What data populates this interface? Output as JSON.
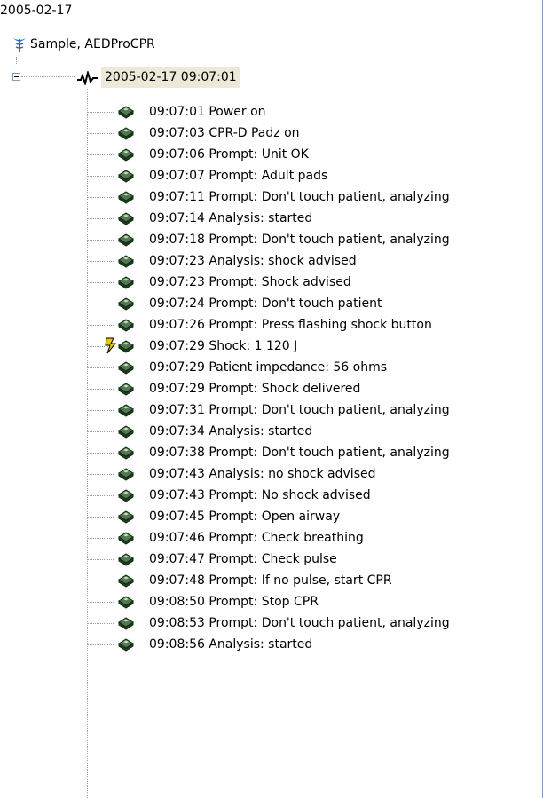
{
  "tree": {
    "root_date": "2005-02-17",
    "patient": {
      "label": "Sample, AEDProCPR",
      "icon": "caduceus-icon"
    },
    "session": {
      "label": "2005-02-17 09:07:01",
      "icon": "ecg-waveform-icon",
      "expanded": true
    },
    "events": [
      {
        "label": "09:07:01 Power on",
        "icon": "device-event-icon"
      },
      {
        "label": "09:07:03 CPR-D Padz on",
        "icon": "device-event-icon"
      },
      {
        "label": "09:07:06 Prompt: Unit OK",
        "icon": "device-event-icon"
      },
      {
        "label": "09:07:07 Prompt: Adult pads",
        "icon": "device-event-icon"
      },
      {
        "label": "09:07:11 Prompt: Don't touch patient, analyzing",
        "icon": "device-event-icon"
      },
      {
        "label": "09:07:14 Analysis: started",
        "icon": "device-event-icon"
      },
      {
        "label": "09:07:18 Prompt: Don't touch patient, analyzing",
        "icon": "device-event-icon"
      },
      {
        "label": "09:07:23 Analysis: shock advised",
        "icon": "device-event-icon"
      },
      {
        "label": "09:07:23 Prompt: Shock advised",
        "icon": "device-event-icon"
      },
      {
        "label": "09:07:24 Prompt: Don't touch patient",
        "icon": "device-event-icon"
      },
      {
        "label": "09:07:26 Prompt: Press flashing shock button",
        "icon": "device-event-icon"
      },
      {
        "label": "09:07:29 Shock: 1 120 J",
        "icon": "shock-event-icon"
      },
      {
        "label": "09:07:29 Patient impedance: 56 ohms",
        "icon": "device-event-icon"
      },
      {
        "label": "09:07:29 Prompt: Shock delivered",
        "icon": "device-event-icon"
      },
      {
        "label": "09:07:31 Prompt: Don't touch patient, analyzing",
        "icon": "device-event-icon"
      },
      {
        "label": "09:07:34 Analysis: started",
        "icon": "device-event-icon"
      },
      {
        "label": "09:07:38 Prompt: Don't touch patient, analyzing",
        "icon": "device-event-icon"
      },
      {
        "label": "09:07:43 Analysis: no shock advised",
        "icon": "device-event-icon"
      },
      {
        "label": "09:07:43 Prompt: No shock advised",
        "icon": "device-event-icon"
      },
      {
        "label": "09:07:45 Prompt: Open airway",
        "icon": "device-event-icon"
      },
      {
        "label": "09:07:46 Prompt: Check breathing",
        "icon": "device-event-icon"
      },
      {
        "label": "09:07:47 Prompt: Check pulse",
        "icon": "device-event-icon"
      },
      {
        "label": "09:07:48 Prompt: If no pulse, start CPR",
        "icon": "device-event-icon"
      },
      {
        "label": "09:08:50 Prompt: Stop CPR",
        "icon": "device-event-icon"
      },
      {
        "label": "09:08:53 Prompt: Don't touch patient, analyzing",
        "icon": "device-event-icon"
      },
      {
        "label": "09:08:56 Analysis: started",
        "icon": "device-event-icon"
      }
    ]
  },
  "colors": {
    "selection": "#ece9d8",
    "border": "#7f9db9",
    "tree_lines": "#a0a0a0",
    "caduceus": "#1f6fd0",
    "device_body": "#2d4d2d",
    "lightning": "#e8c800"
  }
}
